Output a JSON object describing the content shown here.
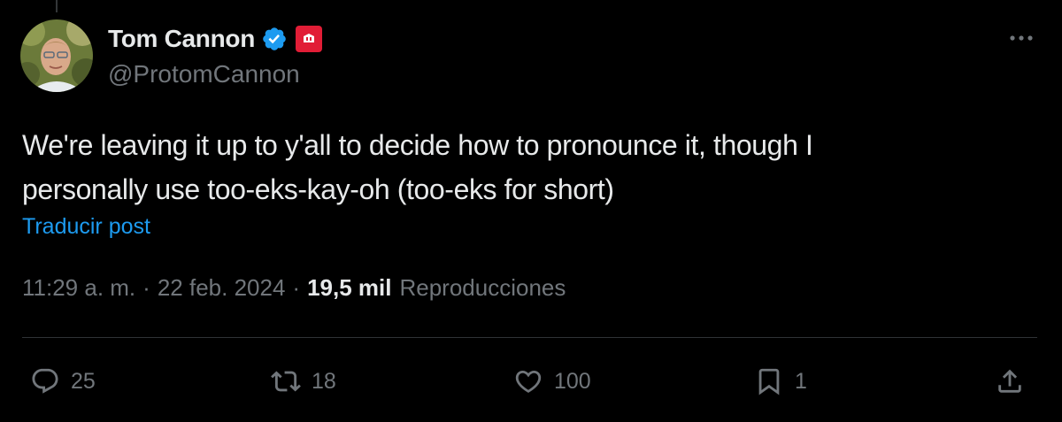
{
  "author": {
    "display_name": "Tom Cannon",
    "handle": "@ProtomCannon",
    "verified_icon": "verified-badge-icon",
    "affiliate_icon": "affiliate-badge-icon"
  },
  "tweet": {
    "text_lines": [
      "We're leaving it up to y'all to decide how to pronounce it, though I",
      "personally use too-eks-kay-oh (too-eks for short)"
    ],
    "translate_label": "Traducir post",
    "time": "11:29 a. m.",
    "date": "22 feb. 2024",
    "views_count": "19,5 mil",
    "views_label": "Reproducciones",
    "separator": "·"
  },
  "actions": {
    "replies": "25",
    "reposts": "18",
    "likes": "100",
    "bookmarks": "1"
  },
  "colors": {
    "background": "#000000",
    "text": "#e7e9ea",
    "muted": "#71767b",
    "link": "#1d9bf0",
    "verified": "#1d9bf0",
    "affiliate": "#e11d36",
    "divider": "#2f3336"
  }
}
